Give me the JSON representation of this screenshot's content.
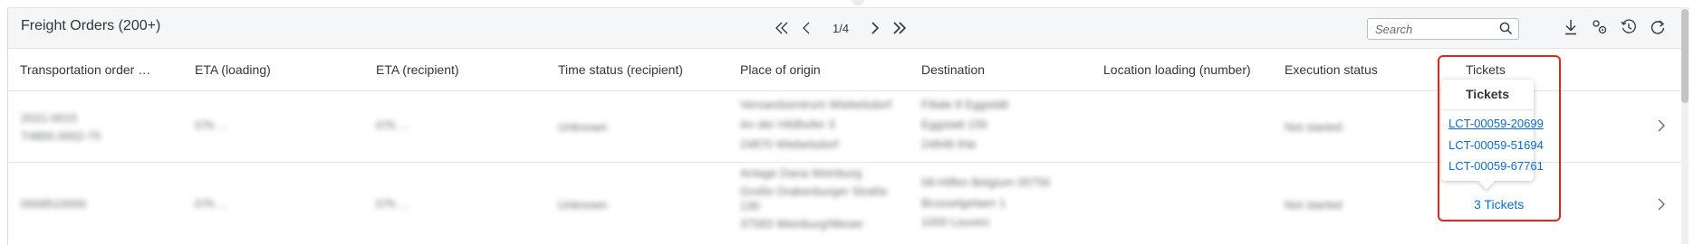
{
  "panel": {
    "title": "Freight Orders (200+)",
    "pager": {
      "page": "1/4"
    },
    "search": {
      "placeholder": "Search"
    },
    "tools": [
      "download-icon",
      "settings-icon",
      "history-icon",
      "refresh-icon"
    ]
  },
  "columns": [
    "Transportation order nu...",
    "ETA (loading)",
    "ETA (recipient)",
    "Time status (recipient)",
    "Place of origin",
    "Destination",
    "Location loading (number)",
    "Execution status",
    "Tickets"
  ],
  "rows": [
    {
      "order_line1": "2021-0015",
      "order_line2": "T4800.0002-75",
      "eta_loading": "07h ...",
      "eta_recipient": "07h ...",
      "time_status": "Unknown",
      "origin": [
        "Versandzentrum Wiebelsdorf",
        "An der Hildhofer 3",
        "24870 Wiebelsdorf"
      ],
      "destination": [
        "Filiale 8 Eggstätt",
        "Eggstatt 156",
        "24848 Ihle"
      ],
      "execution_status": "Not started"
    },
    {
      "order_line1": "0008510000",
      "eta_loading": "07h ...",
      "eta_recipient": "07h ...",
      "time_status": "Unknown",
      "origin": [
        "Anlage Dana Weinburg",
        "Große Drakenburger Straße",
        "130",
        "37583 Weinburg/Weser"
      ],
      "destination": [
        "08-Hilfen Belgium 00756",
        "Brusselgelaen 1",
        "1000 Leuven"
      ],
      "execution_status": "Not started",
      "tickets_summary": "3 Tickets"
    }
  ],
  "tickets_popover": {
    "title": "Tickets",
    "items": [
      "LCT-00059-20699",
      "LCT-00059-51694",
      "LCT-00059-67761"
    ]
  },
  "colors": {
    "link": "#0a6ed1",
    "highlight": "#e2251e"
  }
}
